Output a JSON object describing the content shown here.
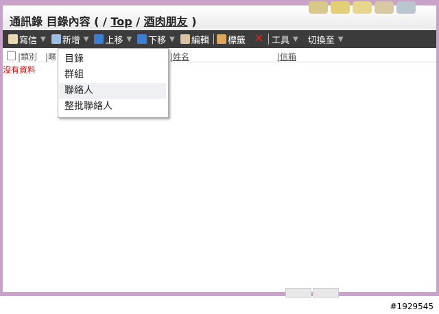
{
  "header": {
    "title_prefix": "通訊錄 目錄內容 ( / ",
    "crumb_top": "Top",
    "crumb_sep": " / ",
    "crumb_folder": "酒肉朋友",
    "title_suffix": " )"
  },
  "toolbar": {
    "write": "寫信",
    "add": "新增",
    "move_up": "上移",
    "move_down": "下移",
    "edit": "編輯",
    "tag": "標籤",
    "tools": "工具",
    "switch_to": "切換至"
  },
  "columns": {
    "category": "類別",
    "nickname": "暱",
    "name": "姓名",
    "email": "信箱"
  },
  "list": {
    "empty_message": "沒有資料"
  },
  "add_menu": {
    "items": [
      "目錄",
      "群組",
      "聯絡人",
      "整批聯絡人"
    ],
    "highlighted_index": 2
  },
  "watermark": "#1929545"
}
